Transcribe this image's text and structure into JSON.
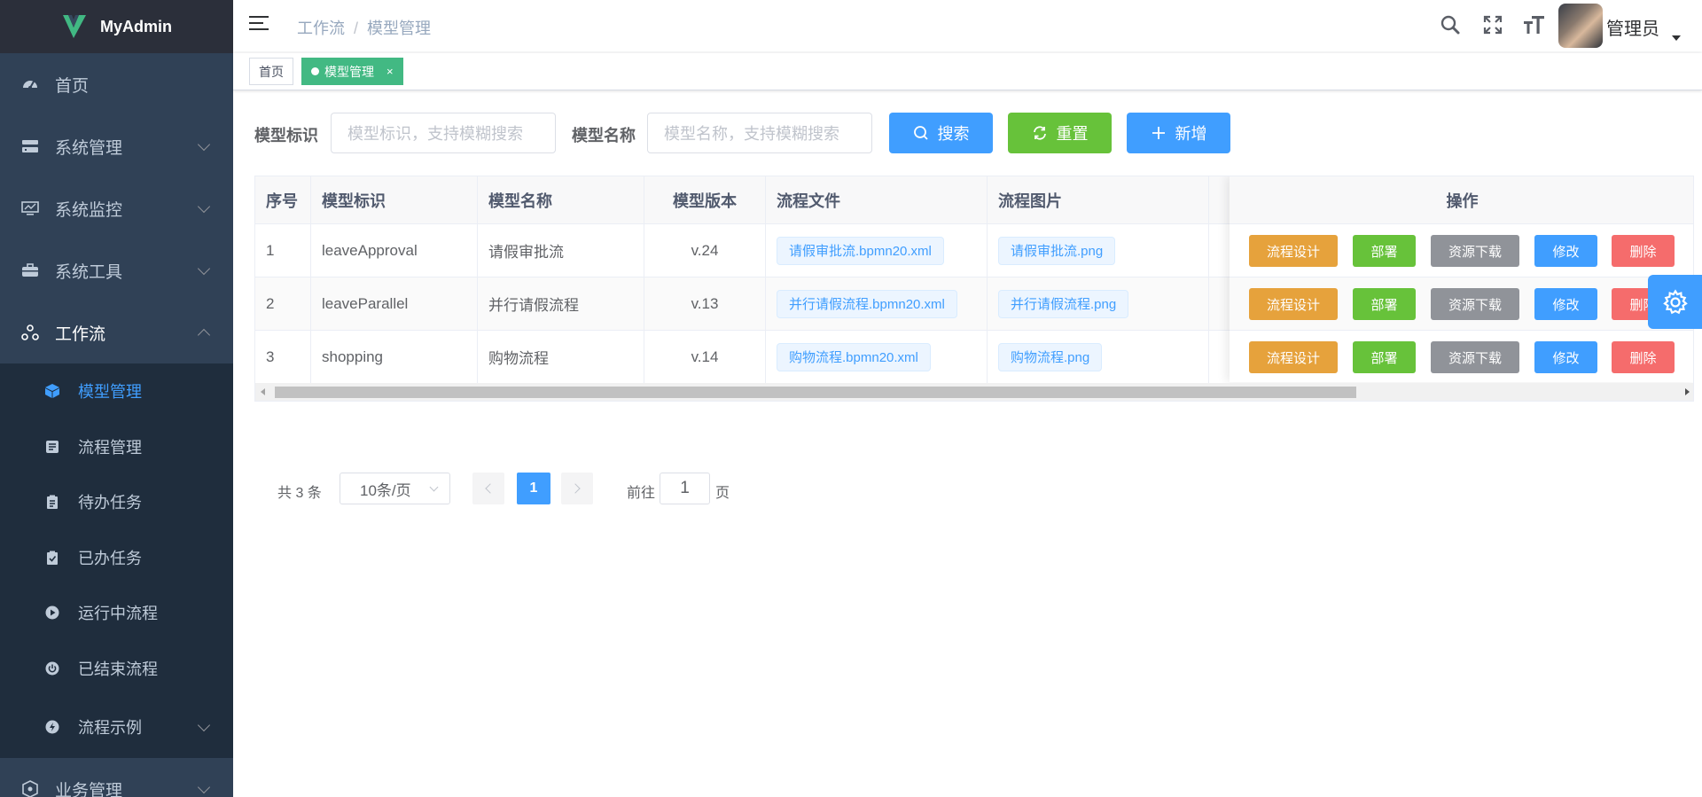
{
  "app": {
    "title": "MyAdmin"
  },
  "sidebar": {
    "items": [
      {
        "label": "首页",
        "icon": "dashboard-icon"
      },
      {
        "label": "系统管理",
        "icon": "system-icon"
      },
      {
        "label": "系统监控",
        "icon": "monitor-icon"
      },
      {
        "label": "系统工具",
        "icon": "tool-icon"
      },
      {
        "label": "工作流",
        "icon": "workflow-icon"
      }
    ],
    "workflow_sub": [
      {
        "label": "模型管理",
        "icon": "cube-icon",
        "active": true
      },
      {
        "label": "流程管理",
        "icon": "process-icon"
      },
      {
        "label": "待办任务",
        "icon": "clipboard-icon"
      },
      {
        "label": "已办任务",
        "icon": "clipboard-check-icon"
      },
      {
        "label": "运行中流程",
        "icon": "play-icon"
      },
      {
        "label": "已结束流程",
        "icon": "power-icon"
      },
      {
        "label": "流程示例",
        "icon": "example-icon"
      }
    ],
    "bottom_item": {
      "label": "业务管理",
      "icon": "business-icon"
    }
  },
  "header": {
    "breadcrumb": [
      "工作流",
      "模型管理"
    ],
    "username": "管理员"
  },
  "tags": [
    {
      "label": "首页",
      "active": false
    },
    {
      "label": "模型管理",
      "active": true
    }
  ],
  "search": {
    "key_label": "模型标识",
    "key_placeholder": "模型标识，支持模糊搜索",
    "name_label": "模型名称",
    "name_placeholder": "模型名称，支持模糊搜索",
    "search_btn": "搜索",
    "reset_btn": "重置",
    "add_btn": "新增"
  },
  "table": {
    "columns": [
      "序号",
      "模型标识",
      "模型名称",
      "模型版本",
      "流程文件",
      "流程图片",
      "操作"
    ],
    "rows": [
      {
        "index": "1",
        "key": "leaveApproval",
        "name": "请假审批流",
        "version": "v.24",
        "file": "请假审批流.bpmn20.xml",
        "image": "请假审批流.png"
      },
      {
        "index": "2",
        "key": "leaveParallel",
        "name": "并行请假流程",
        "version": "v.13",
        "file": "并行请假流程.bpmn20.xml",
        "image": "并行请假流程.png"
      },
      {
        "index": "3",
        "key": "shopping",
        "name": "购物流程",
        "version": "v.14",
        "file": "购物流程.bpmn20.xml",
        "image": "购物流程.png"
      }
    ],
    "actions": {
      "design": "流程设计",
      "deploy": "部署",
      "download": "资源下载",
      "edit": "修改",
      "delete": "删除"
    }
  },
  "pagination": {
    "total_text": "共 3 条",
    "page_size": "10条/页",
    "current_page": "1",
    "goto_label": "前往",
    "goto_value": "1",
    "page_unit": "页"
  },
  "colors": {
    "sidebar_bg": "#304156",
    "primary": "#409eff",
    "success": "#67c23a",
    "warning": "#e6a23c",
    "danger": "#f56c6c",
    "info": "#909399",
    "tag_active": "#42b983"
  }
}
